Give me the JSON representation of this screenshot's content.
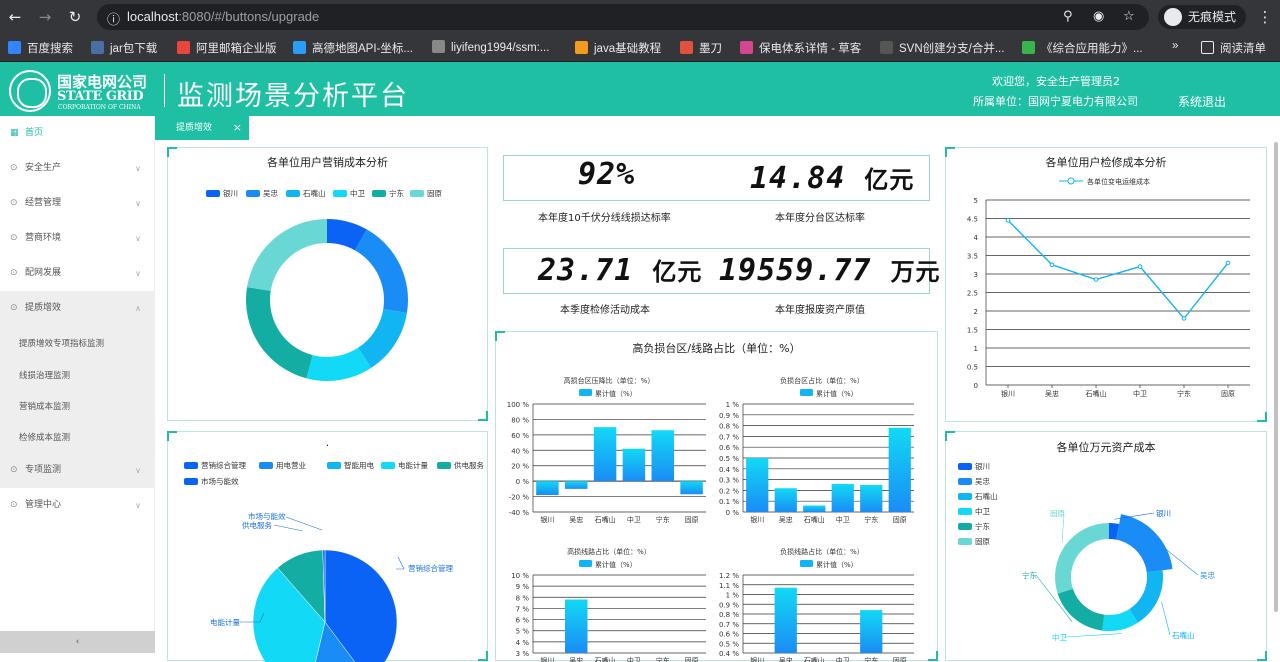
{
  "browser": {
    "url_host": "localhost",
    "url_path": ":8080/#/buttons/upgrade",
    "incognito_label": "无痕模式",
    "bookmarks": [
      "百度搜索",
      "jar包下载",
      "阿里邮箱企业版",
      "高德地图API-坐标...",
      "liyifeng1994/ssm:...",
      "java基础教程",
      "墨刀",
      "保电体系详情 - 草客",
      "SVN创建分支/合并...",
      "《综合应用能力》...",
      "阅读清单"
    ],
    "bookmark_more": "»"
  },
  "header": {
    "brand_cn": "国家电网公司",
    "brand_en": "STATE GRID",
    "brand_corp": "CORPORATION OF CHINA",
    "title": "监测场景分析平台",
    "welcome": "欢迎您，安全生产管理员2",
    "unit": "所属单位：国网宁夏电力有限公司",
    "logout": "系统退出"
  },
  "sidebar": {
    "items": [
      {
        "label": "首页",
        "icon": "grid-icon"
      },
      {
        "label": "安全生产",
        "icon": "pin-icon"
      },
      {
        "label": "经营管理",
        "icon": "pin-icon"
      },
      {
        "label": "营商环境",
        "icon": "pin-icon"
      },
      {
        "label": "配网发展",
        "icon": "pin-icon"
      },
      {
        "label": "提质增效",
        "icon": "pin-icon"
      },
      {
        "label": "专项监测",
        "icon": "pin-icon"
      },
      {
        "label": "管理中心",
        "icon": "pin-icon"
      }
    ],
    "subitems": [
      "提质增效专项指标监测",
      "线损治理监测",
      "营销成本监测",
      "检修成本监测"
    ],
    "collapse": "‹"
  },
  "tabs": [
    {
      "label": "提质增效",
      "close": "×"
    }
  ],
  "kpis": [
    {
      "value": "92%",
      "unit": "",
      "label": "本年度10千伏分线线损达标率"
    },
    {
      "value": "14.84",
      "unit": "亿元",
      "label": "本年度分台区达标率"
    },
    {
      "value": "23.71",
      "unit": "亿元",
      "label": "本季度检修活动成本"
    },
    {
      "value": "19559.77",
      "unit": "万元",
      "label": "本年度报废资产原值"
    }
  ],
  "colors": {
    "c1": "#0b63f6",
    "c2": "#1a8cf5",
    "c3": "#11b5f2",
    "c4": "#12d9f5",
    "c5": "#14ada3",
    "c6": "#69d8d4",
    "teal": "#1fbfa4"
  },
  "chart_data": [
    {
      "type": "pie",
      "title": "各单位用户营销成本分析",
      "categories": [
        "银川",
        "吴忠",
        "石嘴山",
        "中卫",
        "宁东",
        "固原"
      ],
      "values": [
        8,
        19,
        13,
        13,
        23,
        22
      ]
    },
    {
      "type": "line",
      "title": "各单位用户检修成本分析",
      "series": [
        {
          "name": "各单位变电运维成本",
          "values": [
            4.45,
            3.25,
            2.85,
            3.2,
            1.8,
            3.3
          ]
        }
      ],
      "categories": [
        "银川",
        "吴忠",
        "石嘴山",
        "中卫",
        "宁东",
        "固原"
      ],
      "yticks": [
        "0",
        "0.5",
        "1",
        "1.5",
        "2",
        "2.5",
        "3",
        "3.5",
        "4",
        "4.5",
        "5"
      ],
      "ylim": [
        0,
        5
      ]
    },
    {
      "type": "bar",
      "title": "高负损台区/线路占比（单位：%）",
      "subcharts": [
        {
          "title": "高损台区压降比（单位：%）",
          "legend": "累计值（%）",
          "categories": [
            "银川",
            "吴忠",
            "石嘴山",
            "中卫",
            "宁东",
            "固原"
          ],
          "values": [
            -18,
            -10,
            70,
            42,
            66,
            -17
          ],
          "ylim": [
            -40,
            100
          ],
          "yticks": [
            "100 %",
            "80 %",
            "60 %",
            "40 %",
            "20 %",
            "0 %",
            "-20 %",
            "-40 %"
          ]
        },
        {
          "title": "负损台区占比（单位：%）",
          "legend": "累计值（%）",
          "categories": [
            "银川",
            "吴忠",
            "石嘴山",
            "中卫",
            "宁东",
            "固原"
          ],
          "values": [
            0.5,
            0.22,
            0.06,
            0.26,
            0.25,
            0.78
          ],
          "ylim": [
            0,
            1
          ],
          "yticks": [
            "1 %",
            "0.9 %",
            "0.8 %",
            "0.7 %",
            "0.6 %",
            "0.5 %",
            "0.4 %",
            "0.3 %",
            "0.2 %",
            "0.1 %",
            "0 %"
          ]
        },
        {
          "title": "高损线路占比（单位：%）",
          "legend": "累计值（%）",
          "categories": [
            "银川",
            "吴忠",
            "石嘴山",
            "中卫",
            "宁东",
            "固原"
          ],
          "values": [
            0,
            7.8,
            0,
            0,
            0,
            0
          ],
          "ylim": [
            3,
            10
          ],
          "yticks": [
            "10 %",
            "9 %",
            "8 %",
            "7 %",
            "6 %",
            "5 %",
            "4 %",
            "3 %"
          ]
        },
        {
          "title": "负损线路占比（单位：%）",
          "legend": "累计值（%）",
          "categories": [
            "银川",
            "吴忠",
            "石嘴山",
            "中卫",
            "宁东",
            "固原"
          ],
          "values": [
            0,
            1.07,
            0,
            0,
            0.84,
            0
          ],
          "ylim": [
            0.4,
            1.2
          ],
          "yticks": [
            "1.2 %",
            "1.1 %",
            "1 %",
            "0.9 %",
            "0.8 %",
            "0.7 %",
            "0.6 %",
            "0.5 %",
            "0.4 %"
          ]
        }
      ]
    },
    {
      "type": "pie",
      "title": ".",
      "categories": [
        "营销综合管理",
        "用电营业",
        "智能用电",
        "电能计量",
        "供电服务",
        "市场与能效"
      ],
      "labels_shown": [
        "营销综合管理",
        "电能计量",
        "供电服务",
        "市场与能效"
      ],
      "values": [
        40,
        14,
        0,
        35,
        11,
        0.5
      ]
    },
    {
      "type": "pie",
      "title": "各单位万元资产成本",
      "categories": [
        "银川",
        "吴忠",
        "石嘴山",
        "中卫",
        "宁东",
        "固原"
      ],
      "values": [
        3,
        20,
        18,
        11,
        18,
        30
      ]
    }
  ]
}
